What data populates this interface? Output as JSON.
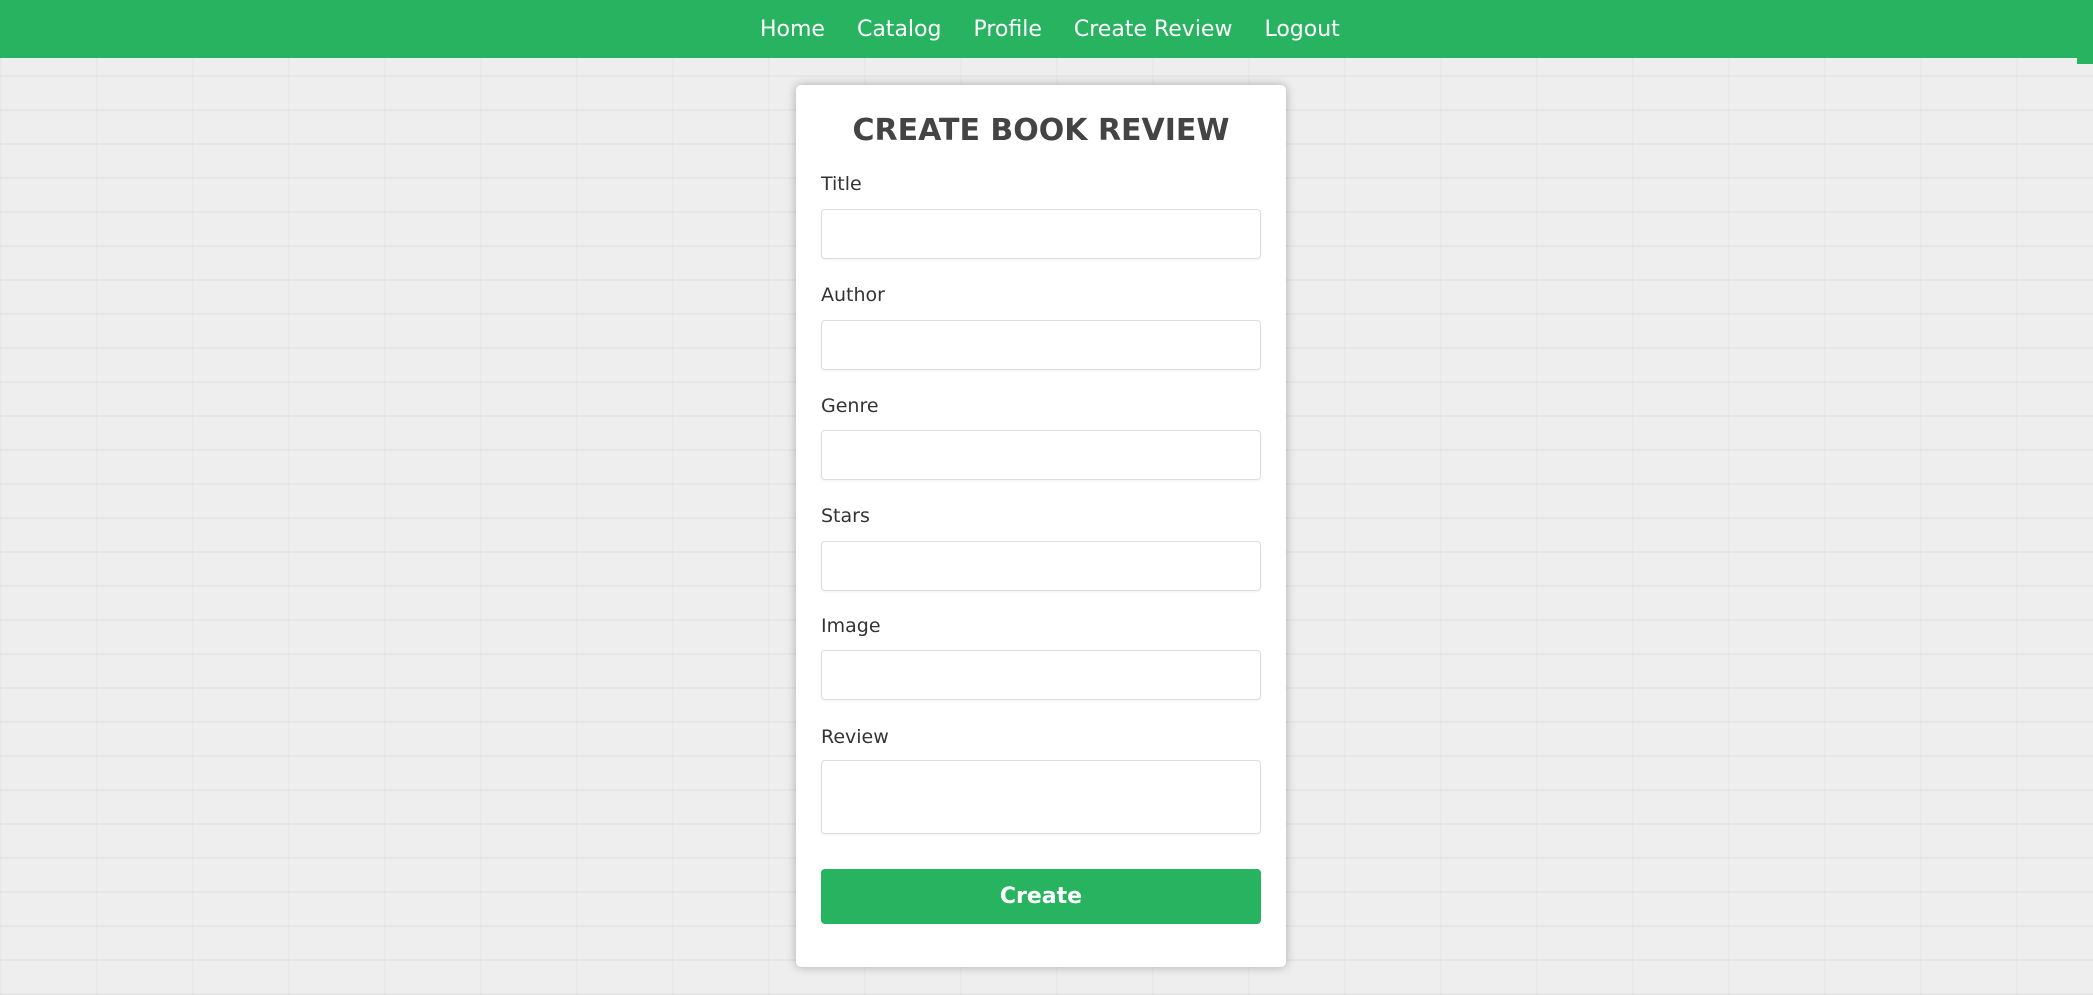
{
  "nav": {
    "items": [
      {
        "label": "Home"
      },
      {
        "label": "Catalog"
      },
      {
        "label": "Profile"
      },
      {
        "label": "Create Review"
      },
      {
        "label": "Logout"
      }
    ]
  },
  "form": {
    "title": "CREATE BOOK REVIEW",
    "fields": {
      "title": {
        "label": "Title",
        "value": ""
      },
      "author": {
        "label": "Author",
        "value": ""
      },
      "genre": {
        "label": "Genre",
        "value": ""
      },
      "stars": {
        "label": "Stars",
        "value": ""
      },
      "image": {
        "label": "Image",
        "value": ""
      },
      "review": {
        "label": "Review",
        "value": ""
      }
    },
    "submit_label": "Create"
  },
  "colors": {
    "brand": "#27b360",
    "heading": "#444444",
    "text": "#333333",
    "background": "#eeeeee"
  }
}
